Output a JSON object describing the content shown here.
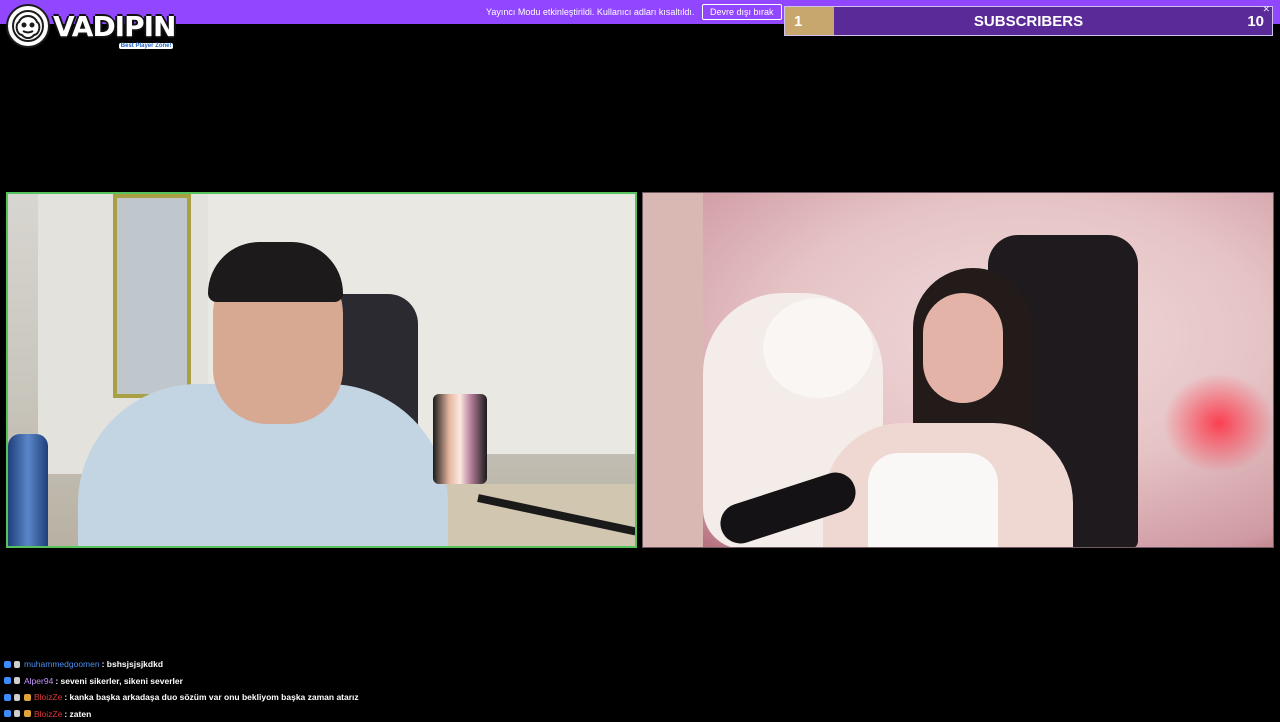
{
  "logo": {
    "name": "VADIPIN",
    "tagline": "Best Player Zone!"
  },
  "banner": {
    "message": "Yayıncı Modu etkinleştirildi. Kullanıcı adları kısaltıldı.",
    "disable_label": "Devre dışı bırak",
    "color": "#9146ff"
  },
  "sub_goal": {
    "current": "1",
    "label": "SUBSCRIBERS",
    "target": "10",
    "progress": 0.1,
    "close_glyph": "✕"
  },
  "chat": [
    {
      "user": "muhammedgoomen",
      "user_color": "#4a8ff0",
      "message": "bshsjsjsjkdkd",
      "badges": [
        "badge-a",
        "badge-b"
      ]
    },
    {
      "user": "Alper94",
      "user_color": "#c893ff",
      "message": "seveni sikerler, sikeni severler",
      "badges": [
        "badge-a",
        "badge-b"
      ]
    },
    {
      "user": "BloizZe",
      "user_color": "#e03a3a",
      "message": "kanka başka arkadaşa duo sözüm var onu bekliyom başka zaman atarız",
      "badges": [
        "badge-a",
        "badge-b",
        "badge-c"
      ]
    },
    {
      "user": "BloizZe",
      "user_color": "#e03a3a",
      "message": "zaten",
      "badges": [
        "badge-a",
        "badge-b",
        "badge-c"
      ]
    }
  ]
}
